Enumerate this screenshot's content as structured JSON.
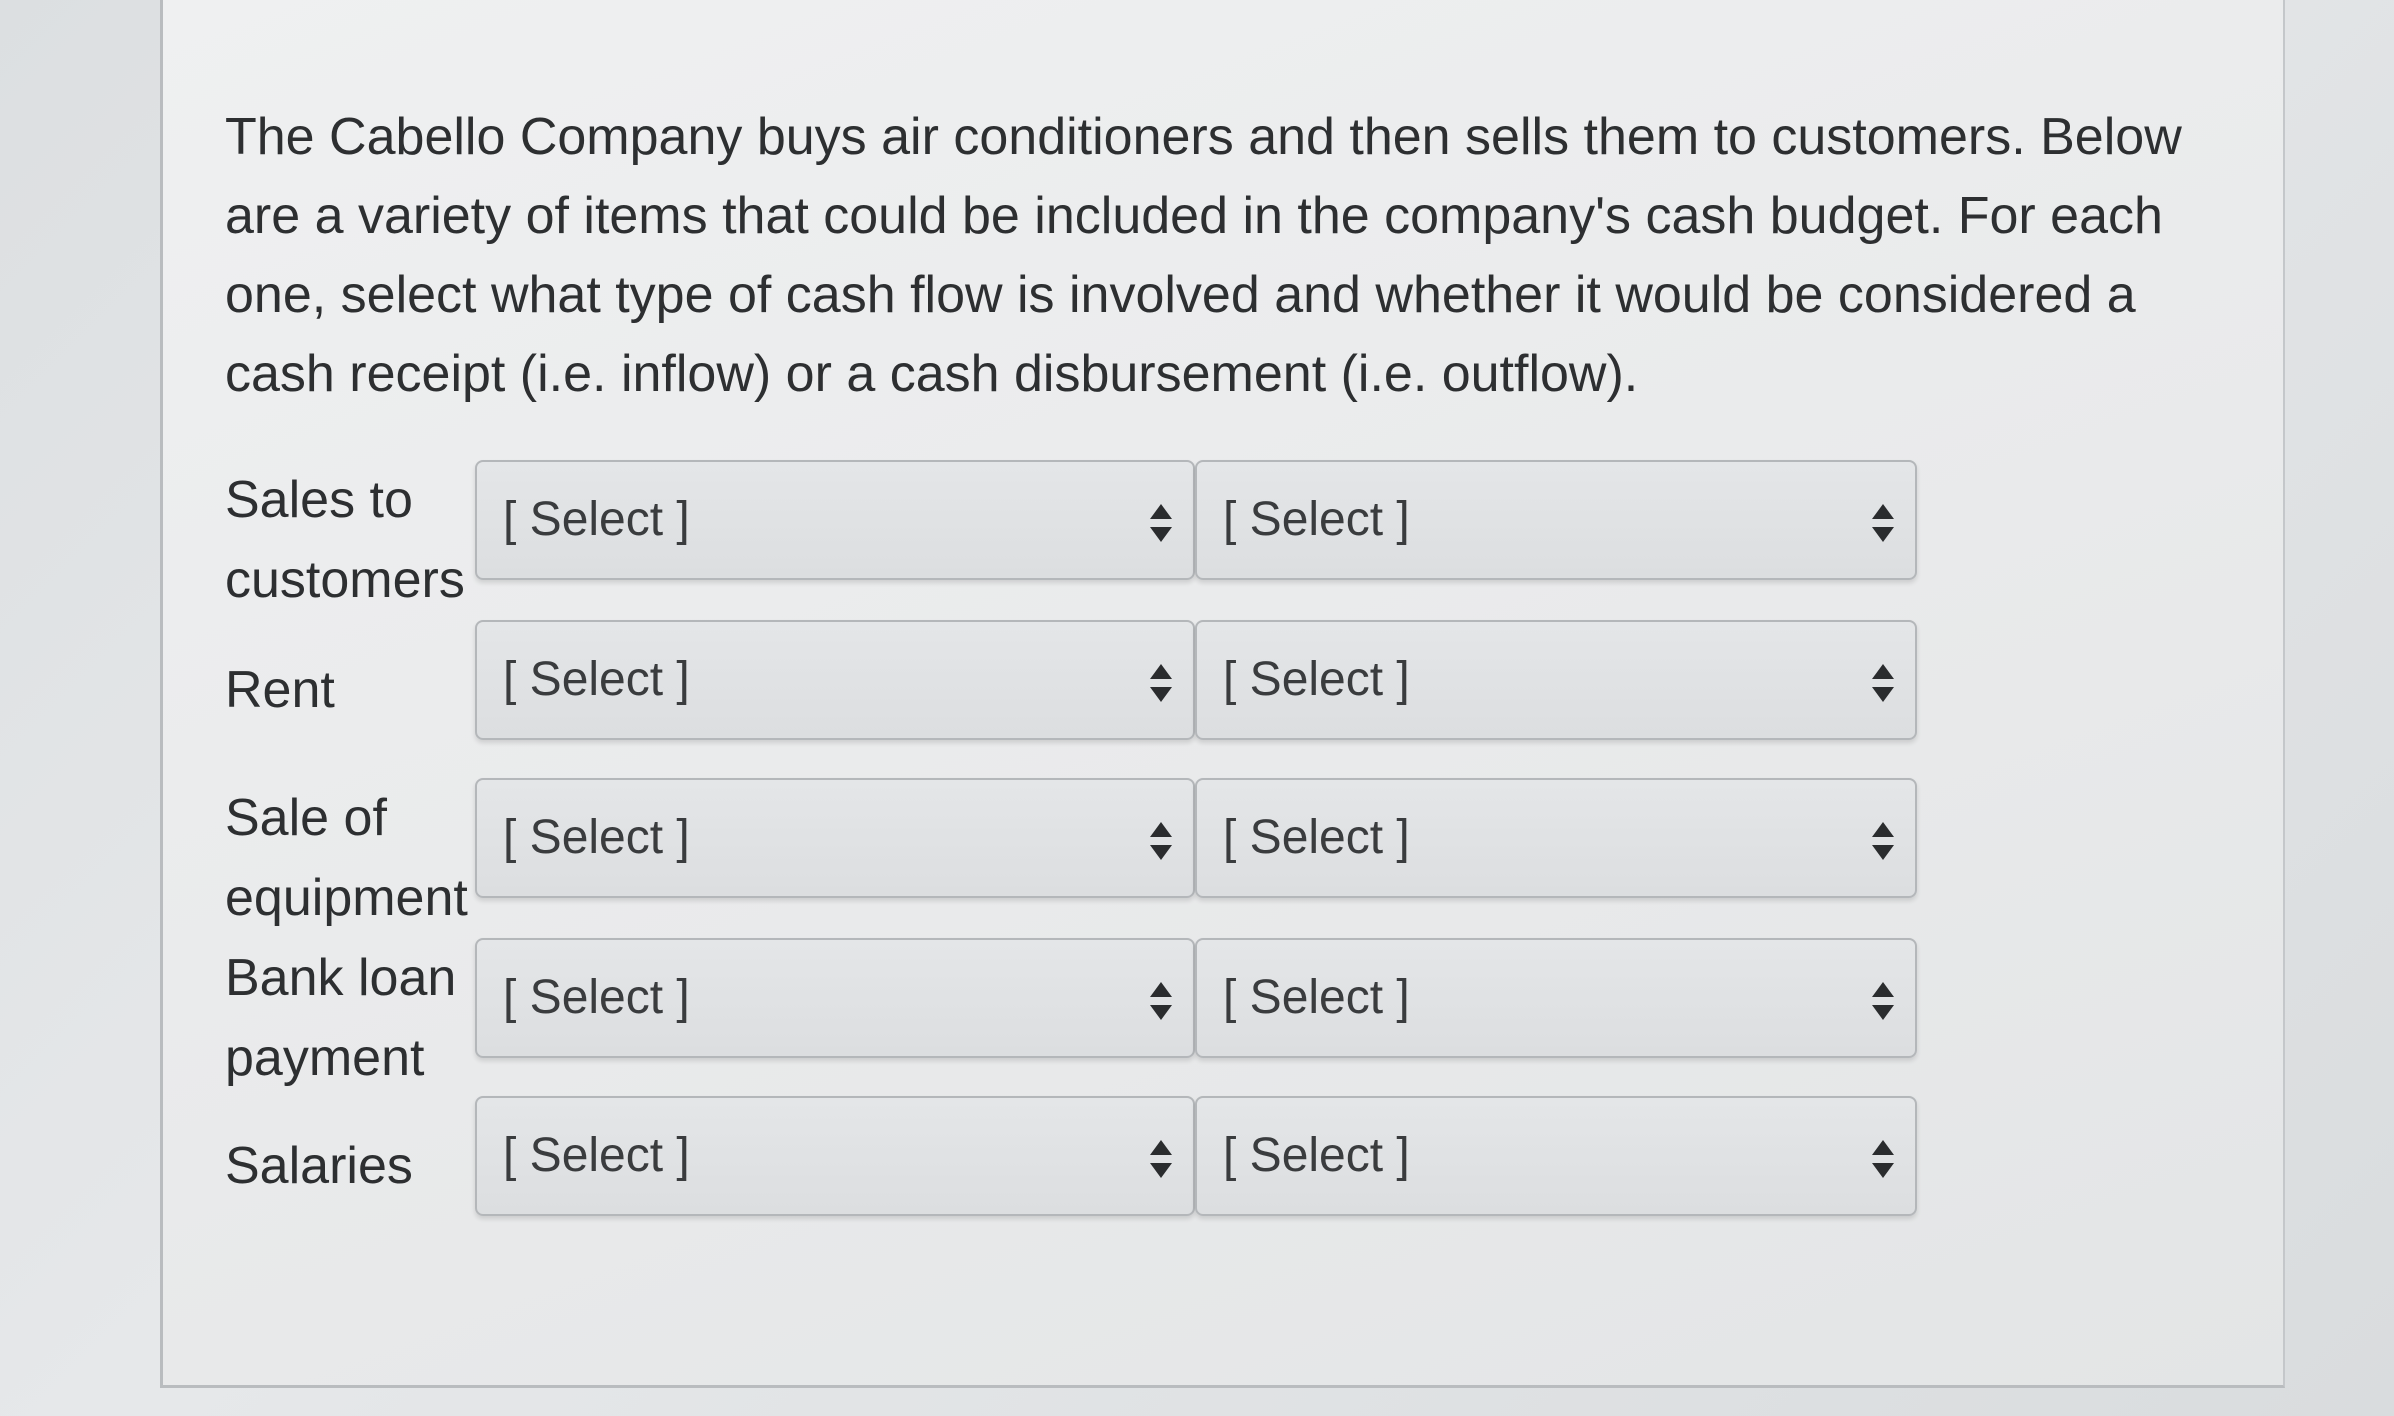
{
  "question": "The Cabello Company buys air conditioners and then sells them to customers.  Below are a variety of items that could be included in the company's cash budget.  For each one, select what type of cash flow is involved and whether it would be considered a cash receipt (i.e. inflow) or a cash disbursement (i.e. outflow).",
  "rows": [
    {
      "label": "Sales to customers",
      "select1": "[ Select ]",
      "select2": "[ Select ]"
    },
    {
      "label": "Rent",
      "select1": "[ Select ]",
      "select2": "[ Select ]"
    },
    {
      "label": "Sale of equipment",
      "select1": "[ Select ]",
      "select2": "[ Select ]"
    },
    {
      "label": "Bank loan payment",
      "select1": "[ Select ]",
      "select2": "[ Select ]"
    },
    {
      "label": "Salaries",
      "select1": "[ Select ]",
      "select2": "[ Select ]"
    }
  ],
  "icons": {
    "dropdown": "up-down-arrow-icon"
  },
  "colors": {
    "text": "#2d2f31",
    "select_background": "#dcdee0",
    "select_border": "#b4b7ba"
  }
}
